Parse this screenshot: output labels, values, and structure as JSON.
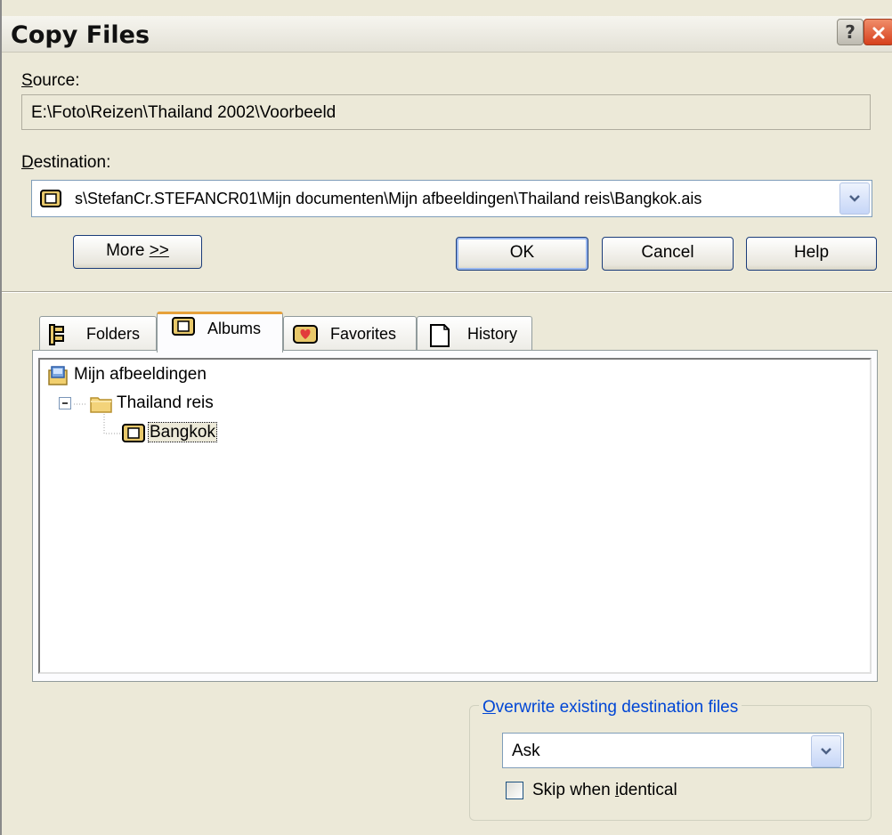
{
  "window": {
    "title": "Copy Files",
    "help_button": "?",
    "close_button": "x"
  },
  "source": {
    "label_underlined": "S",
    "label_rest": "ource:",
    "value": "E:\\Foto\\Reizen\\Thailand 2002\\Voorbeeld"
  },
  "destination": {
    "label_underlined": "D",
    "label_rest": "estination:",
    "value": "s\\StefanCr.STEFANCR01\\Mijn documenten\\Mijn afbeeldingen\\Thailand reis\\Bangkok.ais",
    "icon": "album-icon"
  },
  "buttons": {
    "more_prefix": "More ",
    "more_underlined": ">>",
    "ok": "OK",
    "cancel": "Cancel",
    "help": "Help"
  },
  "tabs": [
    {
      "label": "Folders",
      "icon": "folders-icon",
      "active": false
    },
    {
      "label": "Albums",
      "icon": "album-icon",
      "active": true
    },
    {
      "label": "Favorites",
      "icon": "favorites-heart-icon",
      "active": false
    },
    {
      "label": "History",
      "icon": "history-page-icon",
      "active": false
    }
  ],
  "tree": [
    {
      "label": "Mijn afbeeldingen",
      "icon": "pictures-folder-icon",
      "level": 0
    },
    {
      "label": "Thailand reis",
      "icon": "folder-icon",
      "level": 1,
      "expanded": true
    },
    {
      "label": "Bangkok",
      "icon": "album-icon",
      "level": 2,
      "selected": true
    }
  ],
  "overwrite": {
    "legend_underlined": "O",
    "legend_rest": "verwrite existing destination files",
    "selected_option": "Ask",
    "skip_prefix": "Skip when ",
    "skip_underlined": "i",
    "skip_rest": "dentical",
    "skip_checked": false
  },
  "colors": {
    "dialog_bg": "#ece9d8",
    "link_blue": "#0046d5",
    "tab_highlight": "#e6a13a"
  }
}
